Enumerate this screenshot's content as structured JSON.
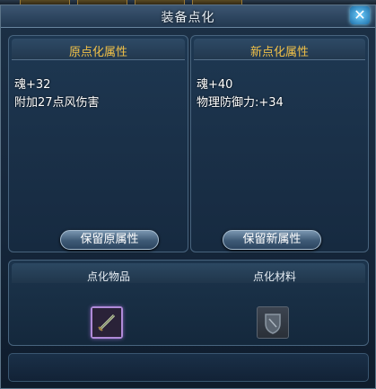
{
  "window": {
    "title": "装备点化",
    "close_icon": "close-icon"
  },
  "original": {
    "title": "原点化属性",
    "attributes": [
      "魂+32",
      "附加27点风伤害"
    ],
    "keep_button": "保留原属性"
  },
  "new": {
    "title": "新点化属性",
    "attributes": [
      "魂+40",
      "物理防御力:+34"
    ],
    "keep_button": "保留新属性"
  },
  "bottom": {
    "item_label": "点化物品",
    "material_label": "点化材料",
    "item_icon": "sword-icon",
    "material_icon": "shield-emblem-icon"
  },
  "colors": {
    "panel_title": "#f0c048",
    "item_slot_border": "#b08ad8"
  }
}
